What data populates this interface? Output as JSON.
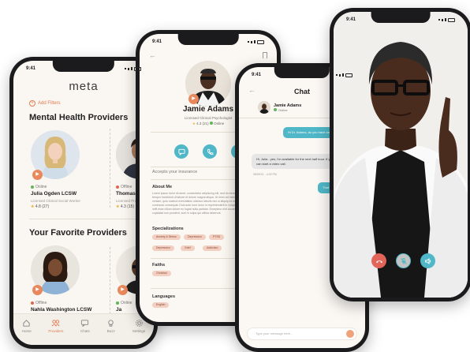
{
  "colors": {
    "accent": "#e8885c",
    "teal": "#4fb7c7",
    "online": "#5fb55a",
    "offline": "#e0674e"
  },
  "phone1": {
    "time": "9:41",
    "brand": "meta",
    "add_filters": "Add Filters",
    "section_mental": "Mental Health Providers",
    "section_favorites": "Your Favorite Providers",
    "providers": [
      {
        "status": "Online",
        "name": "Julia Ogden LCSW",
        "title": "Licensed Clinical Social Worker",
        "rating": "4.8 (27)"
      },
      {
        "status": "Offline",
        "name": "Thomas Par",
        "title": "Licensed Pro",
        "rating": "4.3 (15)"
      }
    ],
    "favorites": [
      {
        "status": "Offline",
        "name": "Nahla Washington LCSW",
        "title": "Licensed Clinical Social Worker"
      },
      {
        "status": "Online",
        "name": "Ja",
        "title": "Licen"
      }
    ],
    "tabs": [
      {
        "label": "Home",
        "icon": "home-icon"
      },
      {
        "label": "Providers",
        "icon": "providers-icon"
      },
      {
        "label": "Chats",
        "icon": "chat-icon"
      },
      {
        "label": "Buzz",
        "icon": "bulb-icon"
      },
      {
        "label": "Settings",
        "icon": "gear-icon"
      }
    ]
  },
  "phone2": {
    "time": "9:41",
    "name": "Jamie Adams",
    "subtitle": "Licensed Clinical Psychologist",
    "rating": "4.3 (21)",
    "presence": "Online",
    "insurance": "Accepts your insurance",
    "about_label": "About Me",
    "about_text": "Lorem ipsum dolor sit amet, consectetur adipiscing elit, sed do eiusmod tempor incididunt ut labore et dolore magna aliqua. Ut enim ad minim veniam, quis nostrud exercitation ullamco laboris nisi ut aliquip ex ea commodo consequat. Duis aute irure dolor in reprehenderit in voluptate velit esse cillum dolore eu fugiat nulla pariatur. Excepteur sint occaecat cupidatat non proident, sunt in culpa qui officia deserunt.",
    "specializations_label": "Specializations",
    "specializations": [
      "Anxiety & Stress",
      "Depression",
      "PTSD",
      "Depression",
      "Grief",
      "Addiction"
    ],
    "faiths_label": "Faiths",
    "faiths": [
      "Christian"
    ],
    "languages_label": "Languages",
    "languages": [
      "English"
    ]
  },
  "phone3": {
    "time": "9:41",
    "title": "Chat",
    "user_name": "Jamie Adams",
    "user_status": "Online",
    "msg1": "Hi Dr. Adams, do you have any time this week? I'm feeling",
    "msg2": "Hi, Julia - yes, I'm available for the next half hour. If you're in a safe space, we can start a video call.",
    "msg2_time": "08/09/21 - 4:32 PM",
    "msg3": "That",
    "input_placeholder": "Type your message here..."
  },
  "phone4": {
    "time": "9:41"
  }
}
